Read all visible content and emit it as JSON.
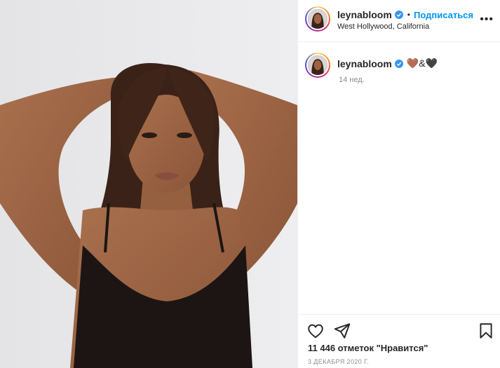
{
  "post": {
    "author": "leynabloom",
    "location": "West Hollywood, California",
    "follow_label": "Подписаться",
    "dot": "•",
    "more_label": "•••",
    "photo_alt": "",
    "caption_text": "🤎&🖤",
    "caption_time": "14 нед.",
    "likes_text": "11 446 отметок \"Нравится\"",
    "date_text": "3 ДЕКАБРЯ 2020 Г."
  },
  "colors": {
    "accent": "#0095f6",
    "text": "#262626",
    "muted": "#8e8e8e",
    "divider": "#efefef"
  },
  "icons": {
    "verified": "verified-badge-icon",
    "like": "heart-icon",
    "share": "paper-plane-icon",
    "save": "bookmark-icon",
    "more": "more-horizontal-icon"
  }
}
